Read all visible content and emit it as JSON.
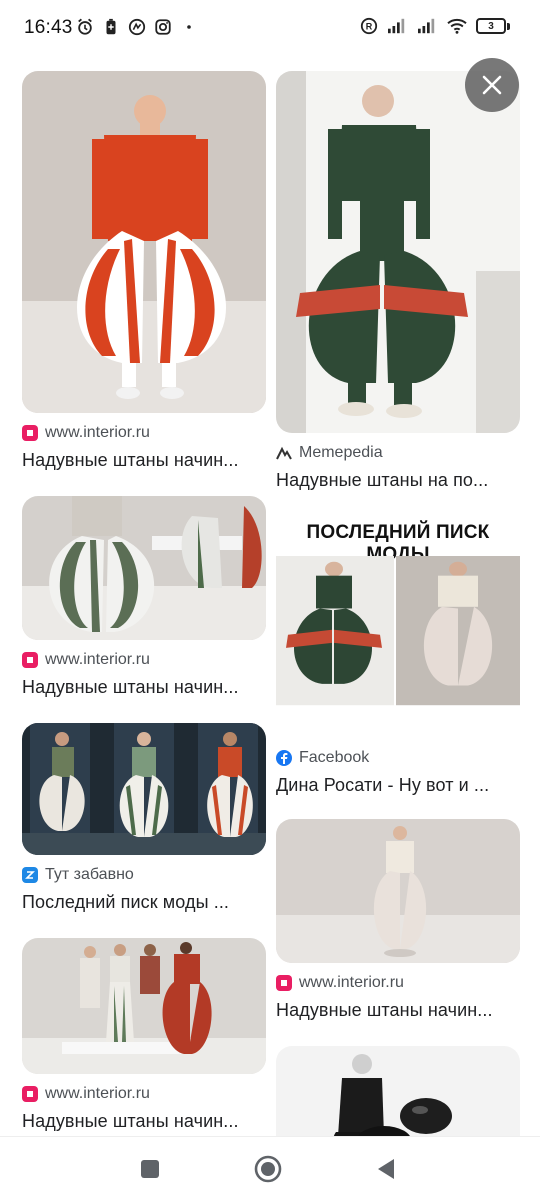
{
  "status_bar": {
    "time": "16:43",
    "left_icons": [
      "alarm-icon",
      "battery-saver-icon",
      "vpn-icon",
      "instagram-icon",
      "dot-icon"
    ],
    "right_icons": [
      "registered-icon",
      "signal-icon",
      "signal-icon",
      "wifi-icon"
    ],
    "battery_level": "3"
  },
  "close_button": {
    "icon": "close-icon"
  },
  "results": {
    "left": [
      {
        "source": "www.interior.ru",
        "title": "Надувные штаны начин...",
        "favicon_color": "#e91e63"
      },
      {
        "source": "www.interior.ru",
        "title": "Надувные штаны начин...",
        "favicon_color": "#e91e63"
      },
      {
        "source": "Тут забавно",
        "title": "Последний писк моды ...",
        "favicon_color": "#1e88e5"
      },
      {
        "source": "www.interior.ru",
        "title": "Надувные штаны начин...",
        "favicon_color": "#e91e63"
      }
    ],
    "right": [
      {
        "source": "Memepedia",
        "title": "Надувные штаны на по...",
        "favicon_color": "#333333"
      },
      {
        "source": "Facebook",
        "title": "Дина Росати - Ну вот и ...",
        "favicon_color": "#1877f2",
        "image_text": "ПОСЛЕДНИЙ ПИСК МОДЫ"
      },
      {
        "source": "www.interior.ru",
        "title": "Надувные штаны начин...",
        "favicon_color": "#e91e63"
      },
      {
        "source": "",
        "title": ""
      }
    ]
  },
  "nav_bar": {
    "buttons": [
      "recents-button",
      "home-button",
      "back-button"
    ]
  }
}
